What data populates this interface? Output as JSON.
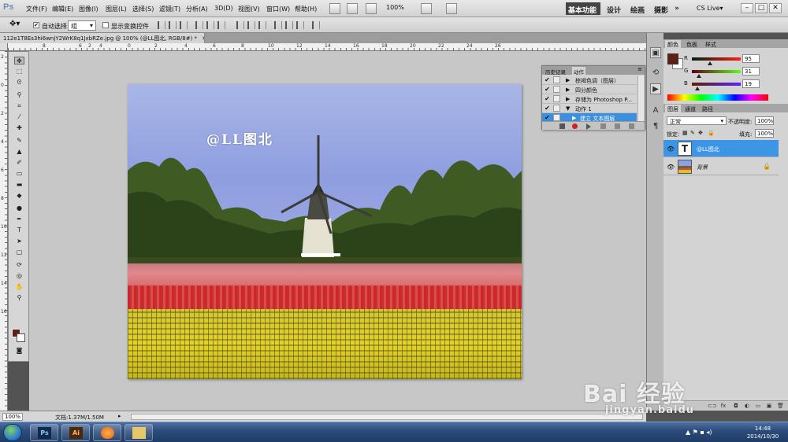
{
  "app": {
    "logo": "Ps"
  },
  "menu": {
    "items": [
      "文件(F)",
      "编辑(E)",
      "图像(I)",
      "图层(L)",
      "选择(S)",
      "滤镜(T)",
      "分析(A)",
      "3D(D)",
      "视图(V)",
      "窗口(W)",
      "帮助(H)"
    ],
    "zoom": "100%",
    "workspaces": [
      "基本功能",
      "设计",
      "绘画",
      "摄影"
    ],
    "more": "»",
    "cs_live": "CS Live▾",
    "window_controls": [
      "–",
      "□",
      "✕"
    ]
  },
  "options_bar": {
    "auto_select_label": "自动选择:",
    "auto_select_value": "组",
    "show_transform_label": "显示变换控件"
  },
  "document": {
    "tab_title": "112e1T8Es3hi6wnjY2WrK8q1JxbRZe.jpg @ 100% (@LL图北, RGB/8#) *",
    "tab_close": "✕",
    "overlay_text": "@LL图北"
  },
  "rulers": {
    "top_ticks": [
      "8",
      "6",
      "4",
      "2",
      "0",
      "2",
      "4",
      "6",
      "8",
      "10",
      "12",
      "14",
      "16",
      "18",
      "20",
      "22",
      "24",
      "26"
    ],
    "left_ticks": [
      "2",
      "0",
      "2",
      "4",
      "6",
      "8",
      "10",
      "12",
      "14",
      "16"
    ]
  },
  "tools": [
    {
      "icon": "move-icon",
      "glyph": "✥"
    },
    {
      "icon": "marquee-icon",
      "glyph": "⬚"
    },
    {
      "icon": "lasso-icon",
      "glyph": "ᘓ"
    },
    {
      "icon": "quick-select-icon",
      "glyph": "⚲"
    },
    {
      "icon": "crop-icon",
      "glyph": "⌗"
    },
    {
      "icon": "eyedropper-icon",
      "glyph": "⁄"
    },
    {
      "icon": "healing-icon",
      "glyph": "✚"
    },
    {
      "icon": "brush-icon",
      "glyph": "✎"
    },
    {
      "icon": "stamp-icon",
      "glyph": "▲"
    },
    {
      "icon": "history-brush-icon",
      "glyph": "✐"
    },
    {
      "icon": "eraser-icon",
      "glyph": "▭"
    },
    {
      "icon": "gradient-icon",
      "glyph": "▬"
    },
    {
      "icon": "blur-icon",
      "glyph": "◆"
    },
    {
      "icon": "dodge-icon",
      "glyph": "●"
    },
    {
      "icon": "pen-icon",
      "glyph": "✒"
    },
    {
      "icon": "type-icon",
      "glyph": "T"
    },
    {
      "icon": "path-select-icon",
      "glyph": "➤"
    },
    {
      "icon": "shape-icon",
      "glyph": "▢"
    },
    {
      "icon": "3d-rotate-icon",
      "glyph": "⟳"
    },
    {
      "icon": "3d-orbit-icon",
      "glyph": "◎"
    },
    {
      "icon": "hand-icon",
      "glyph": "✋"
    },
    {
      "icon": "zoom-icon",
      "glyph": "⚲"
    }
  ],
  "actions_panel": {
    "tabs": [
      "历史记录",
      "动作"
    ],
    "rows": [
      {
        "check": "✔",
        "label": "棕褐色调（图层）"
      },
      {
        "check": "✔",
        "label": "四分颜色"
      },
      {
        "check": "✔",
        "label": "存储为 Photoshop P..."
      },
      {
        "check": "✔",
        "label": "动作 1"
      },
      {
        "check": "✔",
        "label": "建立 文本图层"
      }
    ]
  },
  "color_panel": {
    "tabs": [
      "颜色",
      "色板",
      "样式"
    ],
    "channels": [
      {
        "label": "R",
        "value": "95"
      },
      {
        "label": "G",
        "value": "31"
      },
      {
        "label": "B",
        "value": "19"
      }
    ],
    "foreground": "#5f1f13"
  },
  "layers_panel": {
    "tabs": [
      "图层",
      "通道",
      "路径"
    ],
    "blend_mode": "正常",
    "opacity_label": "不透明度:",
    "opacity_value": "100%",
    "lock_label": "锁定:",
    "fill_label": "填充:",
    "fill_value": "100%",
    "layers": [
      {
        "name": "@LL图北",
        "thumb": "T",
        "selected": true
      },
      {
        "name": "背景",
        "thumb": "",
        "selected": false,
        "locked": true
      }
    ]
  },
  "status_bar": {
    "zoom": "100%",
    "doc_info": "文档:1.37M/1.50M"
  },
  "taskbar": {
    "apps": [
      "Ps",
      "Ai",
      "",
      ""
    ],
    "time": "14:48",
    "date": "2014/10/30"
  },
  "watermark": {
    "logo": "Bai 经验",
    "url": "jingyan.baidu"
  }
}
